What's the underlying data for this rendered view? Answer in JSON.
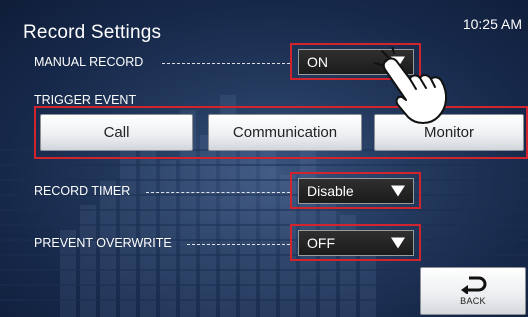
{
  "header": {
    "title": "Record Settings",
    "time": "10:25 AM"
  },
  "manual_record": {
    "label": "MANUAL RECORD",
    "value": "ON"
  },
  "trigger_event": {
    "label": "TRIGGER EVENT",
    "buttons": [
      "Call",
      "Communication",
      "Monitor"
    ]
  },
  "record_timer": {
    "label": "RECORD TIMER",
    "value": "Disable"
  },
  "prevent_overwrite": {
    "label": "PREVENT OVERWRITE",
    "value": "OFF"
  },
  "back": {
    "label": "BACK",
    "icon": "back-arrow-icon"
  },
  "colors": {
    "highlight": "#d2242c",
    "background": "#1b2f52"
  }
}
